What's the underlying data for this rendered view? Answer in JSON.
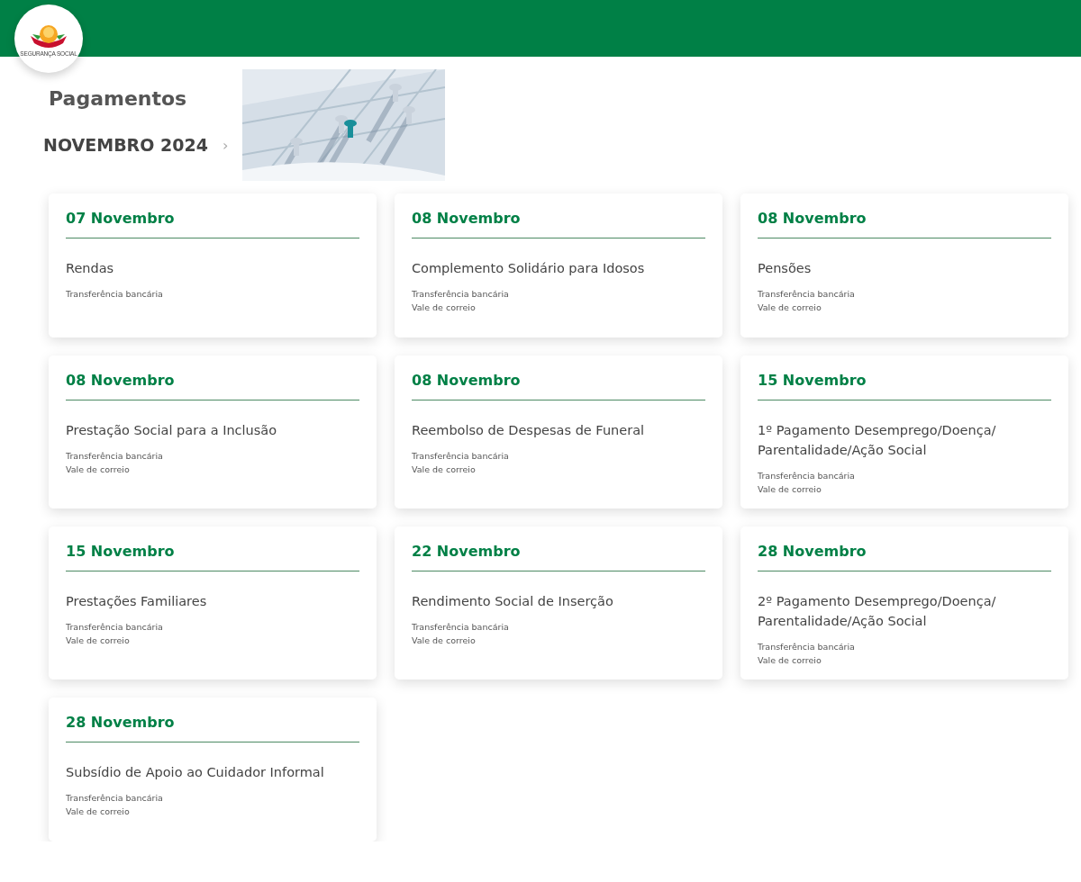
{
  "logo": {
    "text": "SEGURANÇA SOCIAL"
  },
  "page_title": "Pagamentos",
  "month": {
    "label": "NOVEMBRO 2024",
    "chevron": "›"
  },
  "payments": [
    {
      "date": "07 Novembro",
      "title": "Rendas",
      "methods": [
        "Transferência bancária"
      ]
    },
    {
      "date": "08 Novembro",
      "title": "Complemento Solidário para Idosos",
      "methods": [
        "Transferência bancária",
        "Vale de correio"
      ]
    },
    {
      "date": "08 Novembro",
      "title": "Pensões",
      "methods": [
        "Transferência bancária",
        "Vale de correio"
      ]
    },
    {
      "date": "08 Novembro",
      "title": "Prestação Social para a Inclusão",
      "methods": [
        "Transferência bancária",
        "Vale de correio"
      ]
    },
    {
      "date": "08 Novembro",
      "title": "Reembolso de Despesas de Funeral",
      "methods": [
        "Transferência bancária",
        "Vale de correio"
      ]
    },
    {
      "date": "15 Novembro",
      "title": "1º Pagamento Desemprego/Doença/ Parentalidade/Ação Social",
      "methods": [
        "Transferência bancária",
        "Vale de correio"
      ]
    },
    {
      "date": "15 Novembro",
      "title": "Prestações Familiares",
      "methods": [
        "Transferência bancária",
        "Vale de correio"
      ]
    },
    {
      "date": "22 Novembro",
      "title": "Rendimento Social de Inserção",
      "methods": [
        "Transferência bancária",
        "Vale de correio"
      ]
    },
    {
      "date": "28 Novembro",
      "title": "2º Pagamento Desemprego/Doença/ Parentalidade/Ação Social",
      "methods": [
        "Transferência bancária",
        "Vale de correio"
      ]
    },
    {
      "date": "28 Novembro",
      "title": "Subsídio de Apoio ao Cuidador Informal",
      "methods": [
        "Transferência bancária",
        "Vale de correio"
      ]
    }
  ]
}
